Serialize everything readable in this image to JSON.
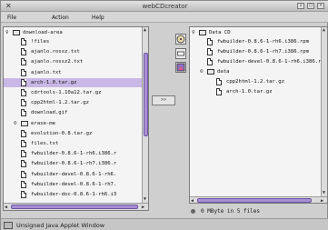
{
  "window": {
    "title": "webCDcreator"
  },
  "menubar": {
    "file": "File",
    "action": "Action",
    "help": "Help"
  },
  "left_tree": {
    "root": "download-area",
    "items": [
      {
        "type": "file",
        "name": "!files"
      },
      {
        "type": "file",
        "name": "ajanlo.rossz.txt"
      },
      {
        "type": "file",
        "name": "ajanlo.rossz2.txt"
      },
      {
        "type": "file",
        "name": "ajanlo.txt"
      },
      {
        "type": "file",
        "name": "arch-1.0.tar.gz",
        "selected": true
      },
      {
        "type": "file",
        "name": "cdrtools-1.10a12.tar.gz"
      },
      {
        "type": "file",
        "name": "cpp2html-1.2.tar.gz"
      },
      {
        "type": "file",
        "name": "download.gif"
      },
      {
        "type": "folder",
        "name": "erase-me"
      },
      {
        "type": "file",
        "name": "evolution-0.8.tar.gz"
      },
      {
        "type": "file",
        "name": "files.txt"
      },
      {
        "type": "file",
        "name": "fwbuilder-0.8.6-1-rh6.i386.r"
      },
      {
        "type": "file",
        "name": "fwbuilder-0.8.6-1-rh7.i386.r"
      },
      {
        "type": "file",
        "name": "fwbuilder-devel-0.8.6-1-rh6."
      },
      {
        "type": "file",
        "name": "fwbuilder-devel-0.8.6-1-rh7."
      },
      {
        "type": "file",
        "name": "fwbuilder-doc-0.8.6-1-rh6.i3"
      }
    ]
  },
  "move_button": {
    "label": ">>"
  },
  "right_tree": {
    "root": "Data CD",
    "items": [
      {
        "type": "file",
        "name": "fwbuilder-0.8.6-1-rh6.i386.rpm",
        "level": 1
      },
      {
        "type": "file",
        "name": "fwbuilder-0.8.6-1-rh7.i386.rpm",
        "level": 1
      },
      {
        "type": "file",
        "name": "fwbuilder-devel-0.8.6-1-rh6.i386.r",
        "level": 1
      },
      {
        "type": "folder",
        "name": "data",
        "level": 1
      },
      {
        "type": "file",
        "name": "cpp2html-1.2.tar.gz",
        "level": 2
      },
      {
        "type": "file",
        "name": "arch-1.0.tar.gz",
        "level": 2
      }
    ]
  },
  "status": {
    "text": "0 MByte in 5 files"
  },
  "footer": {
    "label": "Unsigned Java Applet Window"
  },
  "colors": {
    "selection": "#c9b7e6",
    "scroll_thumb": "#a98fd3"
  },
  "icons": {
    "close": "close-icon",
    "file": "file-icon",
    "folder": "folder-icon",
    "tool1": "cd-burn-icon",
    "tool2": "eject-icon",
    "tool3": "image-icon",
    "java": "java-cup-icon"
  }
}
